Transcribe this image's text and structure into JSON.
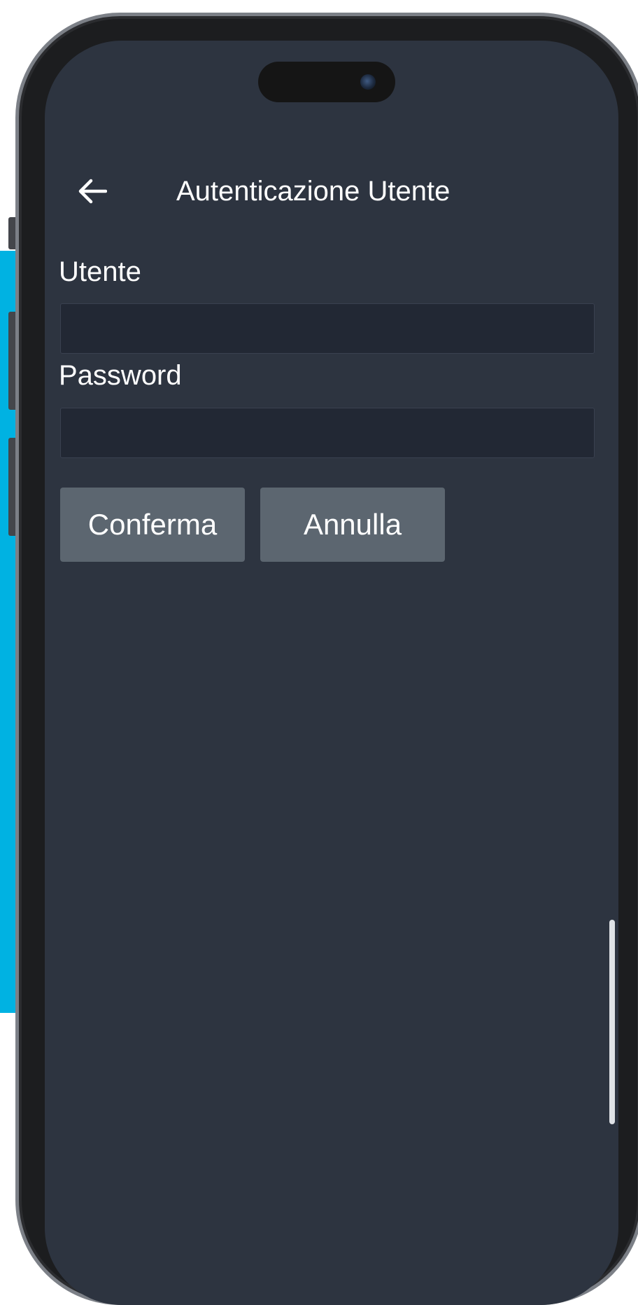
{
  "header": {
    "title": "Autenticazione Utente",
    "back_icon": "arrow-left-icon"
  },
  "form": {
    "user_label": "Utente",
    "user_value": "",
    "password_label": "Password",
    "password_value": ""
  },
  "buttons": {
    "confirm_label": "Conferma",
    "cancel_label": "Annulla"
  },
  "colors": {
    "screen_background": "#2d3440",
    "input_background": "#222834",
    "button_background": "#5c6670",
    "accent": "#00b2e2",
    "text": "#ffffff"
  }
}
